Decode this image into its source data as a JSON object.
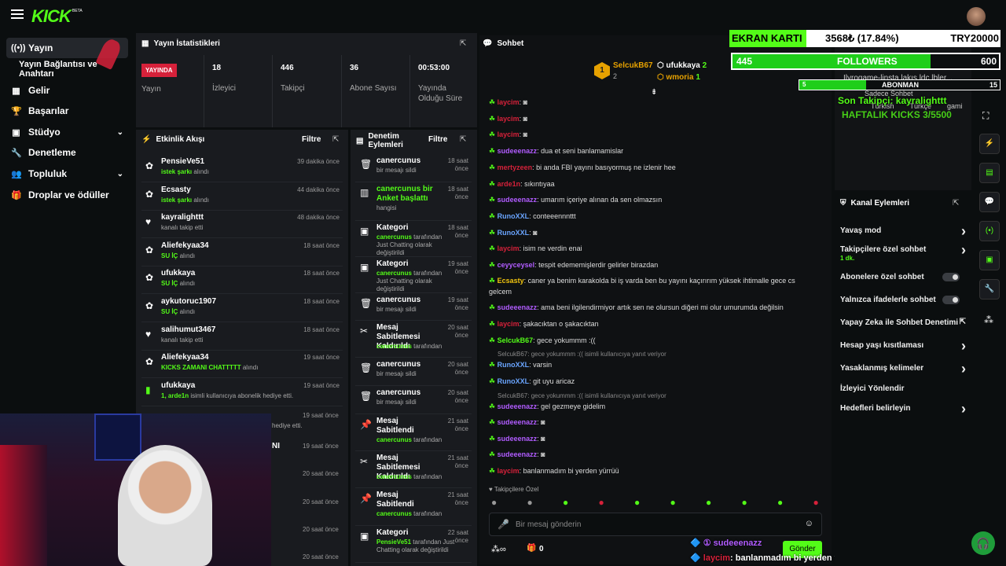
{
  "header": {
    "logo": "KICK",
    "beta": "BETA"
  },
  "sidebar": {
    "items": [
      {
        "label": "Yayın",
        "icon": "broadcast-icon"
      },
      {
        "label": "Yayın Bağlantısı ve Anahtarı"
      },
      {
        "label": "Gelir",
        "icon": "revenue-icon"
      },
      {
        "label": "Başarılar",
        "icon": "trophy-icon"
      },
      {
        "label": "Stüdyo",
        "icon": "studio-icon"
      },
      {
        "label": "Denetleme",
        "icon": "wrench-icon"
      },
      {
        "label": "Topluluk",
        "icon": "community-icon"
      },
      {
        "label": "Droplar ve ödüller",
        "icon": "gift-icon"
      }
    ]
  },
  "stats": {
    "title": "Yayın İstatistikleri",
    "live": "YAYINDA",
    "live_label": "Yayın",
    "items": [
      {
        "value": "18",
        "label": "İzleyici"
      },
      {
        "value": "446",
        "label": "Takipçi"
      },
      {
        "value": "36",
        "label": "Abone Sayısı"
      },
      {
        "value": "00:53:00",
        "label": "Yayında Olduğu Süre"
      }
    ]
  },
  "activity": {
    "title": "Etkinlik Akışı",
    "filter": "Filtre",
    "rows": [
      {
        "name": "PensieVe51",
        "sub_hl": "istek şarkı",
        "sub": " alındı",
        "time": "39 dakika önce",
        "icon": "gift"
      },
      {
        "name": "Ecsasty",
        "sub_hl": "istek şarkı",
        "sub": " alındı",
        "time": "44 dakika önce",
        "icon": "gift"
      },
      {
        "name": "kayralighttt",
        "sub_hl": "",
        "sub": "kanalı takip etti",
        "time": "48 dakika önce",
        "icon": "heart"
      },
      {
        "name": "Aliefekyaa34",
        "sub_hl": "SU İÇ",
        "sub": " alındı",
        "time": "18 saat önce",
        "icon": "gift"
      },
      {
        "name": "ufukkaya",
        "sub_hl": "SU İÇ",
        "sub": " alındı",
        "time": "18 saat önce",
        "icon": "gift"
      },
      {
        "name": "aykutoruc1907",
        "sub_hl": "SU İÇ",
        "sub": " alındı",
        "time": "18 saat önce",
        "icon": "gift"
      },
      {
        "name": "salihumut3467",
        "sub_hl": "",
        "sub": "kanalı takip etti",
        "time": "18 saat önce",
        "icon": "heart"
      },
      {
        "name": "Aliefekyaa34",
        "sub_hl": "KICKS ZAMANI CHATTTTT",
        "sub": " alındı",
        "time": "19 saat önce",
        "icon": "gift"
      },
      {
        "name": "ufukkaya",
        "sub_hl": "1, arde1n",
        "sub": " isimli kullanıcıya abonelik hediye etti.",
        "time": "19 saat önce",
        "icon": "sub"
      }
    ],
    "hidden_rows": [
      {
        "sub": "hediye etti.",
        "time": "19 saat önce"
      },
      {
        "name": "NI",
        "time": "19 saat önce"
      },
      {
        "time": "20 saat önce"
      },
      {
        "time": "20 saat önce"
      },
      {
        "time": "20 saat önce"
      },
      {
        "time": "20 saat önce"
      }
    ]
  },
  "moderation": {
    "title": "Denetim Eylemleri",
    "filter": "Filtre",
    "rows": [
      {
        "name": "canercunus",
        "sub": "bir mesajı sildi",
        "time": "18 saat önce",
        "icon": "trash"
      },
      {
        "name": "canercunus bir Anket başlattı",
        "sub": "hangisi",
        "time": "18 saat önce",
        "icon": "chart"
      },
      {
        "name": "Kategori",
        "sub_hl": "canercunus",
        "sub": " tarafından Just Chatting olarak değiştirildi",
        "time": "18 saat önce",
        "icon": "cat"
      },
      {
        "name": "Kategori",
        "sub_hl": "canercunus",
        "sub": " tarafından Just Chatting olarak değiştirildi",
        "time": "19 saat önce",
        "icon": "cat"
      },
      {
        "name": "canercunus",
        "sub": "bir mesajı sildi",
        "time": "19 saat önce",
        "icon": "trash"
      },
      {
        "name": "Mesaj Sabitlemesi Kaldırıldı",
        "sub_hl": "canercunus",
        "sub": " tarafından",
        "time": "20 saat önce",
        "icon": "unpin"
      },
      {
        "name": "canercunus",
        "sub": "bir mesajı sildi",
        "time": "20 saat önce",
        "icon": "trash"
      },
      {
        "name": "canercunus",
        "sub": "bir mesajı sildi",
        "time": "20 saat önce",
        "icon": "trash"
      },
      {
        "name": "Mesaj Sabitlendi",
        "sub_hl": "canercunus",
        "sub": " tarafından",
        "time": "21 saat önce",
        "icon": "pin"
      },
      {
        "name": "Mesaj Sabitlemesi Kaldırıldı",
        "sub_hl": "canercunus",
        "sub": " tarafından",
        "time": "21 saat önce",
        "icon": "unpin"
      },
      {
        "name": "Mesaj Sabitlendi",
        "sub_hl": "canercunus",
        "sub": " tarafından",
        "time": "21 saat önce",
        "icon": "pin"
      },
      {
        "name": "Kategori",
        "sub_hl": "PensieVe51",
        "sub": " tarafından Just Chatting olarak değiştirildi",
        "time": "22 saat önce",
        "icon": "cat"
      }
    ]
  },
  "chat": {
    "title": "Sohbet",
    "top": [
      {
        "name": "SelcukB67",
        "count": "2",
        "rank": "1"
      },
      {
        "name": "ufukkaya",
        "count": "2"
      },
      {
        "name": "wmoria",
        "count": "1"
      }
    ],
    "messages": [
      {
        "user": "laycim",
        "text": "",
        "color": "#d6213a"
      },
      {
        "user": "laycim",
        "text": "",
        "color": "#d6213a"
      },
      {
        "user": "laycim",
        "text": "",
        "color": "#d6213a"
      },
      {
        "user": "sudeeenazz",
        "text": "dua et seni banlamamislar",
        "color": "#b15cff"
      },
      {
        "user": "mertyzeen",
        "text": "bi anda FBI yayını basıyormuş ne izlenir hee",
        "color": "#d6213a"
      },
      {
        "user": "arde1n",
        "text": "sıkıntıyaa",
        "color": "#d6213a"
      },
      {
        "user": "sudeeenazz",
        "text": "umarım içeriye alınan da sen olmazsın",
        "color": "#b15cff"
      },
      {
        "user": "RunoXXL",
        "text": "conteeennnttt",
        "color": "#6aa5ff"
      },
      {
        "user": "RunoXXL",
        "text": "",
        "color": "#6aa5ff"
      },
      {
        "user": "laycim",
        "text": "isim ne verdin enai",
        "color": "#d6213a"
      },
      {
        "user": "ceyyceysel",
        "text": "tespit edememişlerdir gelirler birazdan",
        "color": "#b15cff"
      },
      {
        "user": "Ecsasty",
        "text": "caner ya benim karakolda bi iş varda ben bu yayını kaçırırım yüksek ihtimalle gece cs",
        "text2": "gelcem",
        "color": "#f1c40f"
      },
      {
        "user": "sudeeenazz",
        "text": "ama beni ilgilendirmiyor artık sen ne olursun diğeri mi olur umurumda değilsin",
        "color": "#b15cff"
      },
      {
        "user": "laycim",
        "text": "şakacıktan o şakacıktan",
        "color": "#d6213a"
      },
      {
        "user": "SelcukB67",
        "text": "gece yokummm :((",
        "color": "#53fc18"
      },
      {
        "reply": "SelcukB67: gece yokummm :(( isimli kullanıcıya yanıt veriyor"
      },
      {
        "user": "RunoXXL",
        "text": "varsin",
        "color": "#6aa5ff"
      },
      {
        "user": "RunoXXL",
        "text": "git uyu aricaz",
        "color": "#6aa5ff"
      },
      {
        "reply": "SelcukB67: gece yokummm :(( isimli kullanıcıya yanıt veriyor"
      },
      {
        "user": "sudeeenazz",
        "text": "gel gezmeye gidelim",
        "color": "#b15cff"
      },
      {
        "user": "sudeeenazz",
        "text": "",
        "color": "#b15cff"
      },
      {
        "user": "sudeeenazz",
        "text": "",
        "color": "#b15cff"
      },
      {
        "user": "sudeeenazz",
        "text": "",
        "color": "#b15cff"
      },
      {
        "user": "laycim",
        "text": "banlanmadım bi yerden yürrüü",
        "color": "#d6213a"
      }
    ],
    "followers_only": "Takipçilere Özel",
    "input_placeholder": "Bir mesaj gönderin",
    "points": "0",
    "send": "Gönder",
    "overlay_lines": [
      {
        "user": "sudeeenazz",
        "text": ""
      },
      {
        "user": "laycim",
        "text": ": banlanmadım bi yerden yürrüü"
      }
    ]
  },
  "overlay": {
    "gpu_label": "EKRAN KARTI",
    "gpu_price": "3568₺ (17.84%)",
    "gpu_goal": "TRY20000",
    "followers": "445",
    "followers_label": "FOLLOWERS",
    "followers_goal": "600",
    "followers_progress": 0.742,
    "subs": "5",
    "subs_label": "ABONMAN",
    "subs_goal": "15",
    "subs_progress": 0.333,
    "last_follower": "Son Takipçi: kayralighttt",
    "kicks": "HAFTALIK KICKS 3/5500",
    "frame_line1": "Ilyrogame-linsta lakış ldc lbler...",
    "frame_line2": "Sadece Sohbet",
    "tags": [
      "Türkish",
      "Türkçe",
      "gami"
    ]
  },
  "channel_actions": {
    "title": "Kanal Eylemleri",
    "items": [
      {
        "label": "Yavaş mod",
        "kind": "chevron"
      },
      {
        "label": "Takipçilere özel sohbet",
        "sub": "1 dk.",
        "kind": "chevron"
      },
      {
        "label": "Abonelere özel sohbet",
        "kind": "toggle"
      },
      {
        "label": "Yalnızca ifadelerle sohbet",
        "kind": "toggle"
      },
      {
        "label": "Yapay Zeka ile Sohbet Denetimi",
        "kind": "ext"
      },
      {
        "label": "Hesap yaşı kısıtlaması",
        "kind": "chevron"
      },
      {
        "label": "Yasaklanmış kelimeler",
        "kind": "chevron"
      },
      {
        "label": "İzleyici Yönlendir",
        "kind": "none"
      },
      {
        "label": "Hedefleri belirleyin",
        "kind": "chevron"
      }
    ]
  }
}
